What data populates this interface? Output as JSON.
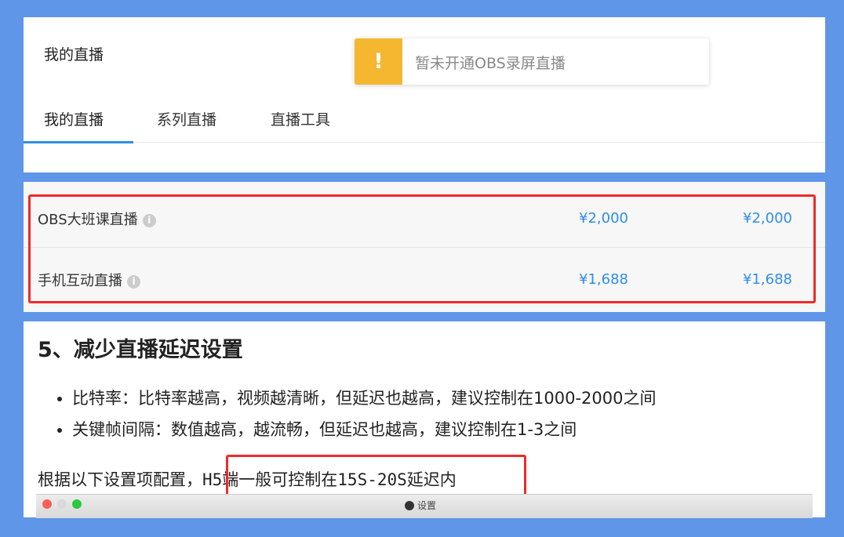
{
  "header": {
    "page_title": "我的直播",
    "toast": {
      "icon_text": "!",
      "message": "暂未开通OBS录屏直播"
    },
    "tabs": [
      {
        "label": "我的直播",
        "active": true
      },
      {
        "label": "系列直播",
        "active": false
      },
      {
        "label": "直播工具",
        "active": false
      }
    ]
  },
  "pricing": {
    "rows": [
      {
        "name": "OBS大班课直播",
        "info_icon": "i",
        "price1": "¥2,000",
        "price2": "¥2,000"
      },
      {
        "name": "手机互动直播",
        "info_icon": "i",
        "price1": "¥1,688",
        "price2": "¥1,688"
      }
    ]
  },
  "article": {
    "heading": "5、减少直播延迟设置",
    "bullets": [
      "比特率：比特率越高，视频越清晰，但延迟也越高，建议控制在1000-2000之间",
      "关键帧间隔：数值越高，越流畅，但延迟也越高，建议控制在1-3之间"
    ],
    "para_prefix": "根据以下设置项配置，",
    "para_highlight": "H5端一般可控制在15S-20S延迟内",
    "window_title": "设置"
  },
  "colors": {
    "background": "#5f96e8",
    "accent_blue": "#2f8ee6",
    "warning": "#f6b730",
    "highlight_red": "#ee2a2a"
  }
}
